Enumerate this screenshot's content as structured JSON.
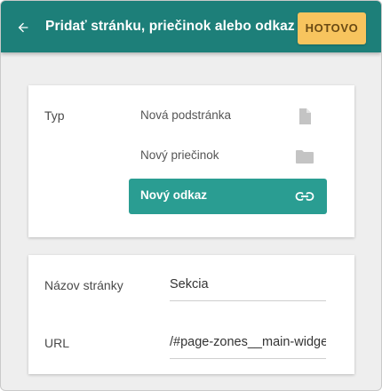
{
  "header": {
    "title": "Pridať stránku, priečinok alebo odkaz",
    "done_label": "HOTOVO",
    "accent_color": "#1d7f79",
    "done_color": "#f7c45e"
  },
  "type_section": {
    "label": "Typ",
    "options": [
      {
        "label": "Nová podstránka",
        "icon": "file-icon",
        "selected": false
      },
      {
        "label": "Nový priečinok",
        "icon": "folder-icon",
        "selected": false
      },
      {
        "label": "Nový odkaz",
        "icon": "link-icon",
        "selected": true
      }
    ],
    "selected_color": "#2a9d92"
  },
  "page_section": {
    "name_label": "Názov stránky",
    "name_value": "Sekcia",
    "url_label": "URL",
    "url_value": "/#page-zones__main-widgets"
  }
}
